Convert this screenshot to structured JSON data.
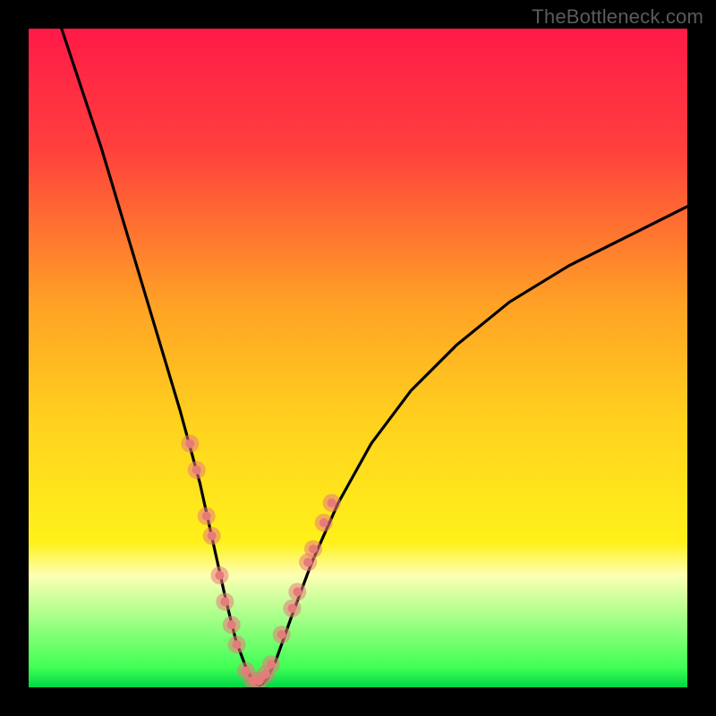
{
  "watermark": "TheBottleneck.com",
  "chart_data": {
    "type": "line",
    "title": "",
    "xlabel": "",
    "ylabel": "",
    "xlim": [
      0,
      100
    ],
    "ylim": [
      0,
      100
    ],
    "grid": false,
    "legend": false,
    "background_gradient_stops": [
      {
        "offset": 0.0,
        "color": "#ff1a48"
      },
      {
        "offset": 0.18,
        "color": "#ff3f3d"
      },
      {
        "offset": 0.42,
        "color": "#ffa225"
      },
      {
        "offset": 0.6,
        "color": "#ffd21e"
      },
      {
        "offset": 0.78,
        "color": "#fff11a"
      },
      {
        "offset": 0.83,
        "color": "#fdffb4"
      },
      {
        "offset": 0.97,
        "color": "#3fff54"
      },
      {
        "offset": 1.0,
        "color": "#00d646"
      }
    ],
    "series": [
      {
        "name": "bottleneck-curve",
        "color": "#000000",
        "x": [
          5,
          8,
          11,
          14,
          17,
          20,
          23,
          26,
          28,
          30,
          31.5,
          33,
          34,
          35,
          36,
          37.5,
          40,
          43,
          47,
          52,
          58,
          65,
          73,
          82,
          92,
          100
        ],
        "y": [
          100,
          91,
          82,
          72,
          62,
          52,
          42,
          31,
          22,
          13,
          7,
          3,
          1,
          0.3,
          1,
          4,
          11,
          19,
          28,
          37,
          45,
          52,
          58.5,
          64,
          69,
          73
        ]
      }
    ],
    "markers": {
      "name": "highlight-points",
      "color": "#e77a7a",
      "radius_outer": 10,
      "radius_inner": 5,
      "x": [
        24.5,
        25.5,
        27.0,
        27.8,
        29.0,
        29.8,
        30.8,
        31.6,
        33.0,
        34.0,
        35.0,
        36.0,
        36.8,
        38.4,
        40.0,
        40.8,
        42.4,
        43.2,
        44.8,
        46.0
      ],
      "y": [
        37.0,
        33.0,
        26.0,
        23.0,
        17.0,
        13.0,
        9.5,
        6.5,
        2.5,
        1.0,
        1.0,
        2.0,
        3.5,
        8.0,
        12.0,
        14.5,
        19.0,
        21.0,
        25.0,
        28.0
      ]
    }
  }
}
